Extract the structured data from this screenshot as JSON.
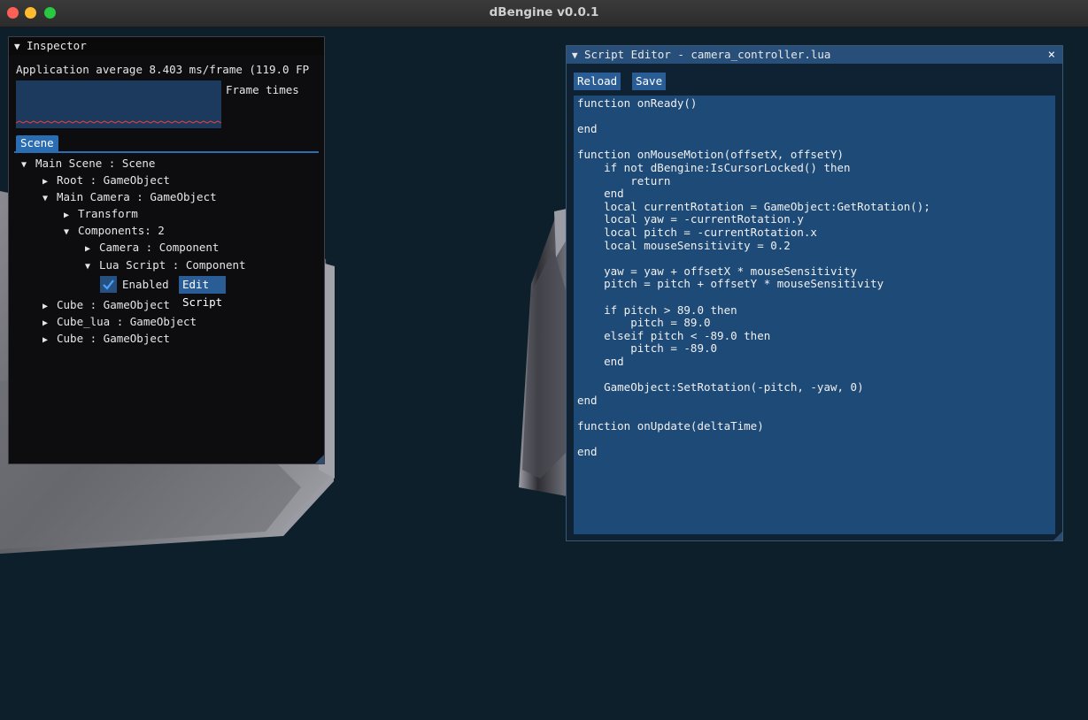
{
  "window": {
    "title": "dBengine v0.0.1"
  },
  "inspector": {
    "title": "Inspector",
    "stats": "Application average 8.403 ms/frame (119.0 FP",
    "plot_label": "Frame times",
    "tab": "Scene",
    "tree": {
      "scene": "Main Scene : Scene",
      "root": "Root : GameObject",
      "main_camera": "Main Camera : GameObject",
      "transform": "Transform",
      "components": "Components: 2",
      "camera": "Camera : Component",
      "lua_script": "Lua Script : Component",
      "enabled_label": "Enabled",
      "enabled": true,
      "edit_script": "Edit Script",
      "cube1": "Cube : GameObject",
      "cube_lua": "Cube_lua : GameObject",
      "cube2": "Cube : GameObject"
    }
  },
  "editor": {
    "title": "Script Editor - camera_controller.lua",
    "close_glyph": "×",
    "reload": "Reload",
    "save": "Save",
    "code": "function onReady()\n\nend\n\nfunction onMouseMotion(offsetX, offsetY)\n    if not dBengine:IsCursorLocked() then\n        return\n    end\n    local currentRotation = GameObject:GetRotation();\n    local yaw = -currentRotation.y\n    local pitch = -currentRotation.x\n    local mouseSensitivity = 0.2\n\n    yaw = yaw + offsetX * mouseSensitivity\n    pitch = pitch + offsetY * mouseSensitivity\n\n    if pitch > 89.0 then\n        pitch = 89.0\n    elseif pitch < -89.0 then\n        pitch = -89.0\n    end\n\n    GameObject:SetRotation(-pitch, -yaw, 0)\nend\n\nfunction onUpdate(deltaTime)\n\nend"
  },
  "colors": {
    "background": "#0e1f2c",
    "accent": "#2a6db3",
    "plot_line": "#e03a3a"
  }
}
